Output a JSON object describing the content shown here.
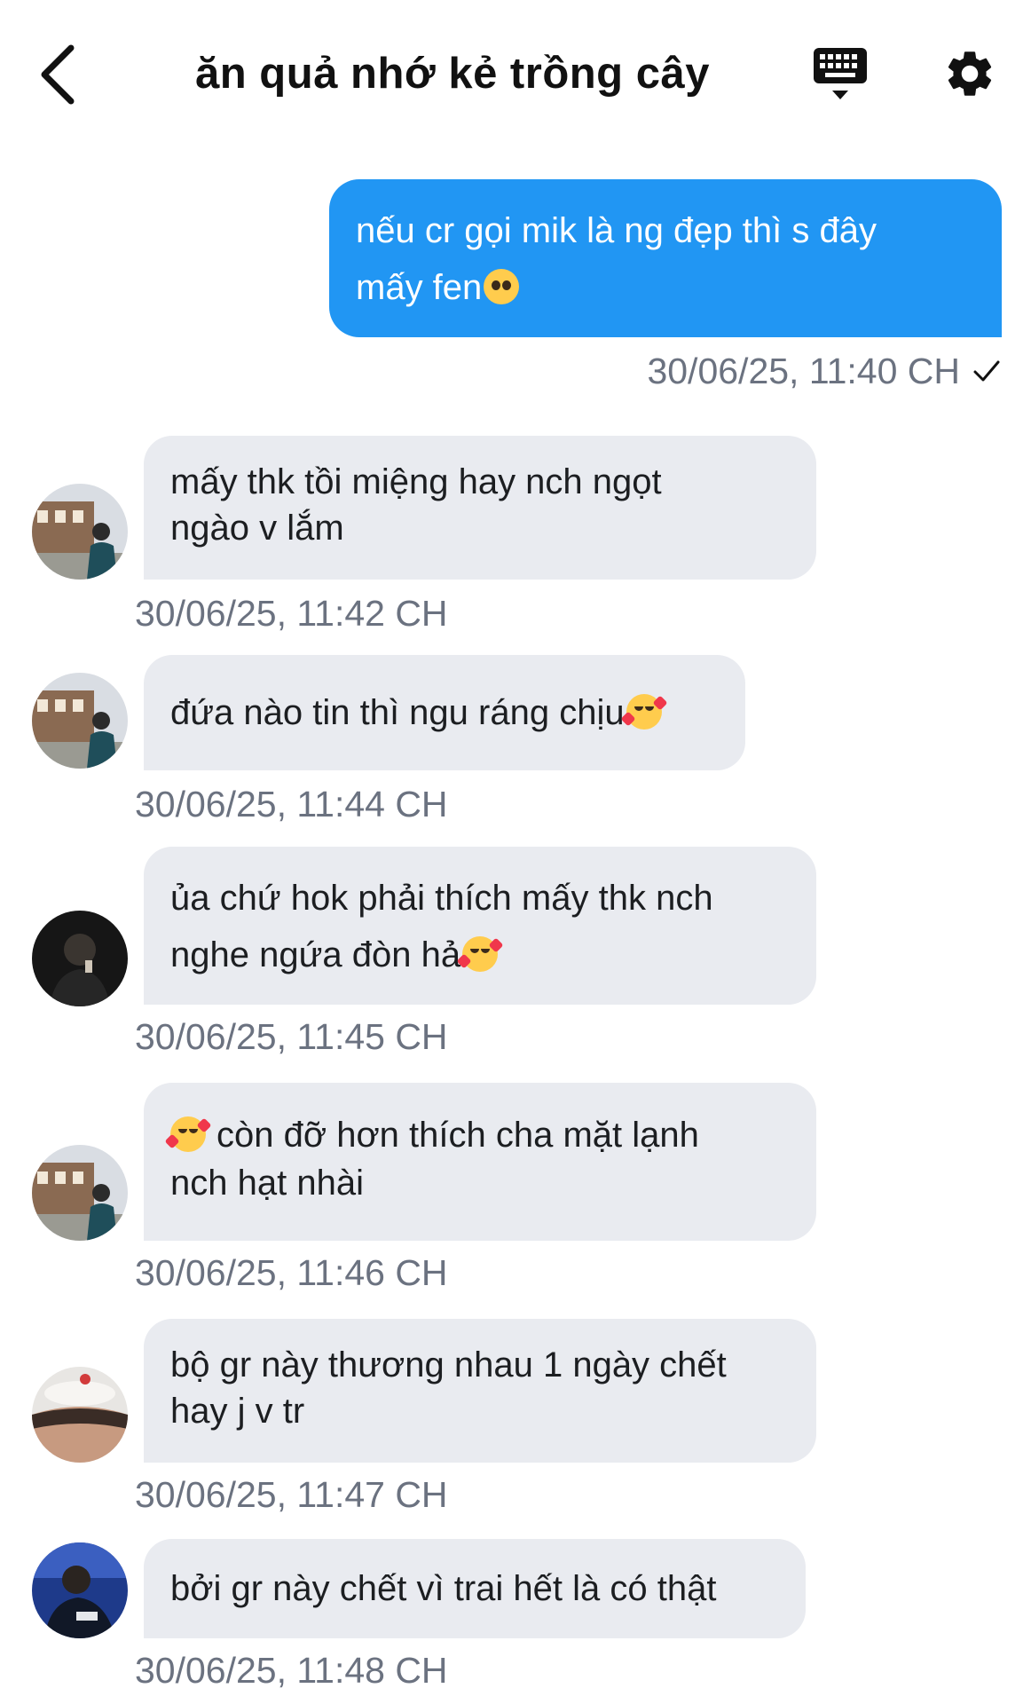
{
  "header": {
    "title": "ăn quả nhớ kẻ trồng cây",
    "back_icon": "chevron-left-icon",
    "keyboard_icon": "keyboard-icon",
    "settings_icon": "gear-icon"
  },
  "colors": {
    "outgoing_bubble": "#2196f3",
    "incoming_bubble": "#e9ebf0",
    "timestamp": "#6b7280"
  },
  "messages": [
    {
      "dir": "out",
      "lines": [
        "nếu cr gọi mik là ng đẹp thì s đây",
        "mấy fen"
      ],
      "emoji": "pleading-face",
      "time": "30/06/25, 11:40 CH",
      "status": "sent-check-icon"
    },
    {
      "dir": "in",
      "avatar": "avatar-building",
      "lines": [
        "mấy thk tồi miệng hay nch ngọt",
        "ngào v lắm"
      ],
      "time": "30/06/25, 11:42 CH"
    },
    {
      "dir": "in",
      "avatar": "avatar-building",
      "lines": [
        "đứa nào tin thì ngu ráng chịu"
      ],
      "emoji": "smiling-face-with-hearts",
      "time": "30/06/25, 11:44 CH"
    },
    {
      "dir": "in",
      "avatar": "avatar-dark",
      "lines": [
        "ủa chứ hok phải thích mấy thk nch",
        "nghe ngứa đòn hả"
      ],
      "emoji": "smiling-face-with-hearts",
      "time": "30/06/25, 11:45 CH"
    },
    {
      "dir": "in",
      "avatar": "avatar-building",
      "lines": [
        "còn đỡ hơn thích cha mặt lạnh",
        "nch hạt nhài"
      ],
      "emoji_lead": "smiling-face-with-hearts",
      "time": "30/06/25, 11:46 CH"
    },
    {
      "dir": "in",
      "avatar": "avatar-girl",
      "lines": [
        "bộ gr này thương nhau 1 ngày chết",
        "hay j v tr"
      ],
      "time": "30/06/25, 11:47 CH"
    },
    {
      "dir": "in",
      "avatar": "avatar-player",
      "lines": [
        "bởi gr này chết vì trai hết là có thật"
      ],
      "time": "30/06/25, 11:48 CH"
    }
  ]
}
